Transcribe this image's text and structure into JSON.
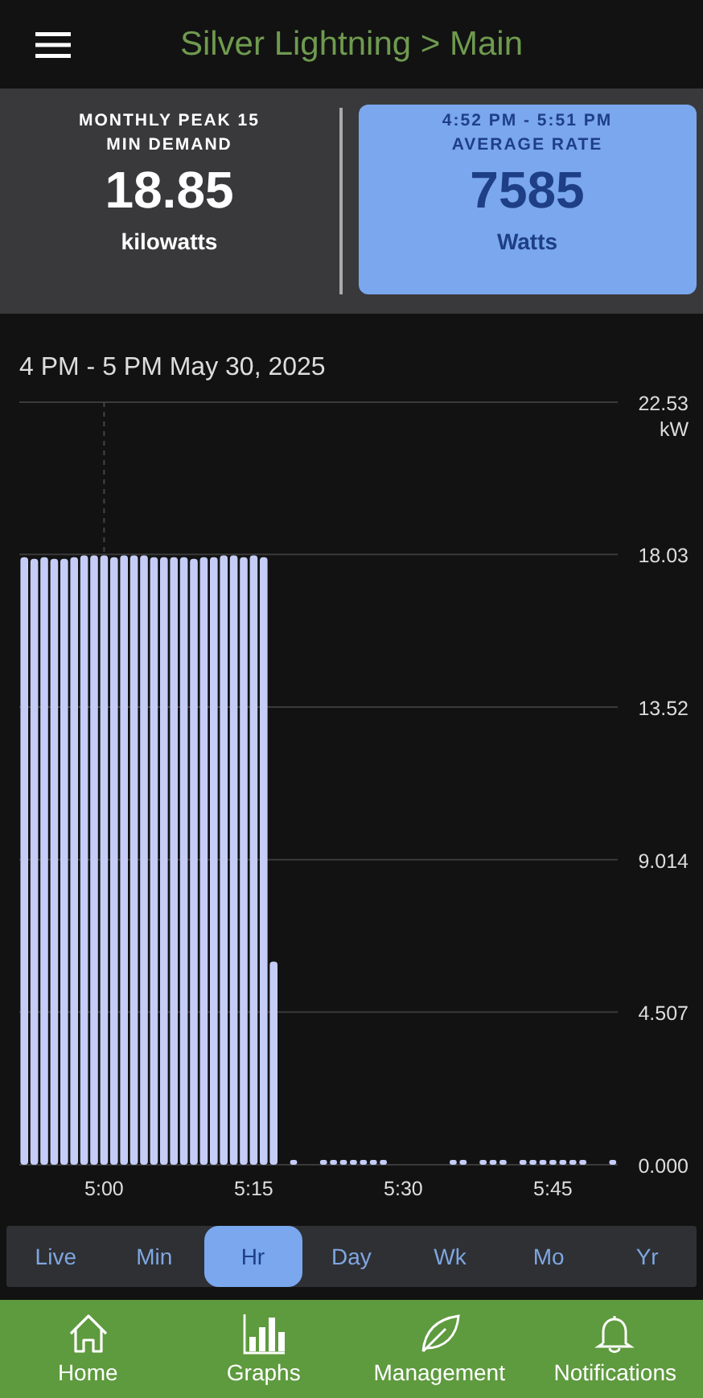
{
  "header": {
    "title": "Silver Lightning > Main"
  },
  "cards": [
    {
      "kind": "peak",
      "lines": [
        "MONTHLY PEAK 15",
        "MIN DEMAND"
      ],
      "value": "18.85",
      "unit": "kilowatts"
    },
    {
      "kind": "average",
      "lines": [
        "4:52 PM - 5:51 PM",
        "AVERAGE RATE"
      ],
      "value": "7585",
      "unit": "Watts"
    }
  ],
  "chart": {
    "title": "4 PM - 5 PM May 30, 2025",
    "chart_data": {
      "type": "bar",
      "ylabel": "kW",
      "categories": [
        null,
        null,
        null,
        null,
        null,
        null,
        null,
        null,
        "5:00",
        null,
        null,
        null,
        null,
        null,
        null,
        null,
        null,
        null,
        null,
        null,
        null,
        null,
        null,
        "5:15",
        null,
        null,
        null,
        null,
        null,
        null,
        null,
        null,
        null,
        null,
        null,
        null,
        null,
        null,
        "5:30",
        null,
        null,
        null,
        null,
        null,
        null,
        null,
        null,
        null,
        null,
        null,
        null,
        null,
        null,
        "5:45",
        null,
        null,
        null,
        null,
        null,
        null
      ],
      "series": [
        {
          "color": "#c5cdf7",
          "values": [
            17.95,
            17.9,
            17.95,
            17.9,
            17.9,
            17.95,
            18.0,
            18.0,
            18.0,
            17.95,
            18.0,
            18.0,
            18.0,
            17.95,
            17.95,
            17.95,
            17.95,
            17.9,
            17.95,
            17.95,
            18.0,
            18.0,
            17.95,
            18.0,
            17.95,
            6.0,
            null,
            0,
            null,
            null,
            0,
            0,
            0,
            0,
            0,
            0,
            0,
            null,
            null,
            null,
            null,
            null,
            null,
            0,
            0,
            null,
            0,
            0,
            0,
            null,
            0,
            0,
            0,
            0,
            0,
            0,
            0,
            null,
            null,
            0
          ]
        }
      ],
      "ylim": [
        0,
        22.53
      ],
      "grid": true,
      "yticks": [
        {
          "value": 0,
          "label": "0.000"
        },
        {
          "value": 4.507,
          "label": "4.507"
        },
        {
          "value": 9.014,
          "label": "9.014"
        },
        {
          "value": 13.52,
          "label": "13.52"
        },
        {
          "value": 18.03,
          "label": "18.03"
        },
        {
          "value": 22.53,
          "label": "22.53"
        }
      ]
    }
  },
  "ranges": [
    {
      "label": "Live",
      "selected": false
    },
    {
      "label": "Min",
      "selected": false
    },
    {
      "label": "Hr",
      "selected": true
    },
    {
      "label": "Day",
      "selected": false
    },
    {
      "label": "Wk",
      "selected": false
    },
    {
      "label": "Mo",
      "selected": false
    },
    {
      "label": "Yr",
      "selected": false
    }
  ],
  "nav": [
    {
      "kind": "home",
      "label": "Home"
    },
    {
      "kind": "graphs",
      "label": "Graphs"
    },
    {
      "kind": "leaf",
      "label": "Management"
    },
    {
      "kind": "bell",
      "label": "Notifications"
    }
  ]
}
